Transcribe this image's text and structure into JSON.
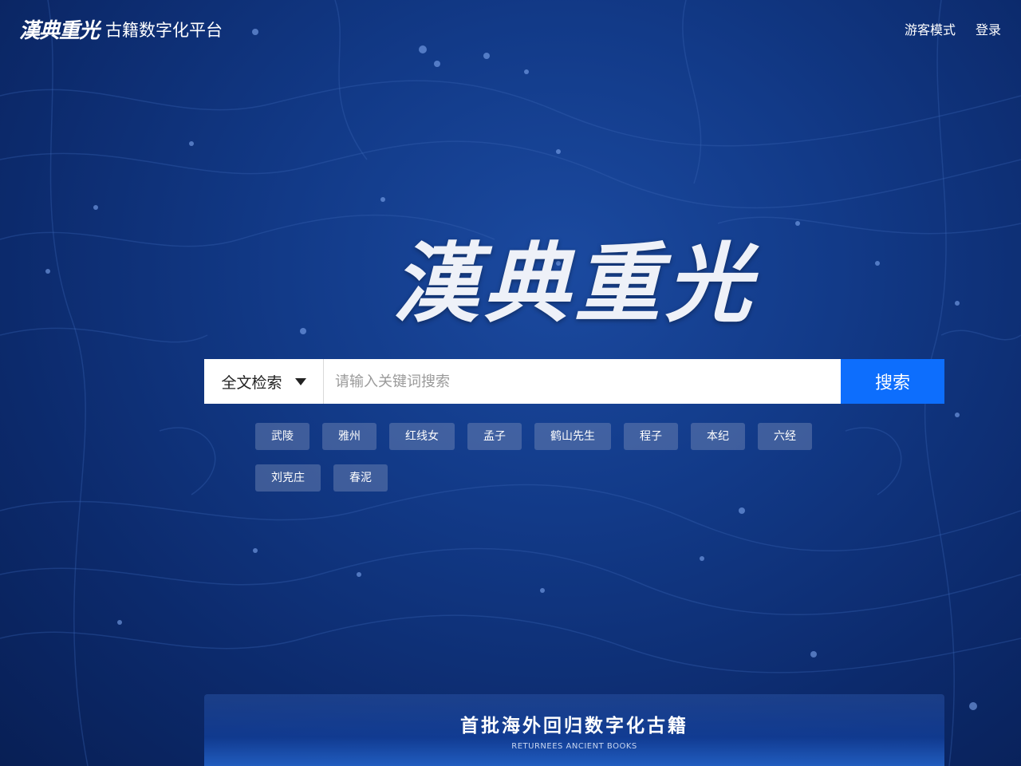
{
  "header": {
    "logo_text": "漢典重光",
    "platform_name": "古籍数字化平台",
    "guest_mode": "游客模式",
    "login": "登录"
  },
  "hero": {
    "title": "漢典重光"
  },
  "search": {
    "type_selected": "全文检索",
    "placeholder": "请输入关键词搜索",
    "button": "搜索"
  },
  "tags": [
    "武陵",
    "雅州",
    "红线女",
    "孟子",
    "鹤山先生",
    "程子",
    "本纪",
    "六经",
    "刘克庄",
    "春泥"
  ],
  "panel": {
    "title": "首批海外回归数字化古籍",
    "subtitle": "RETURNEES ANCIENT BOOKS"
  },
  "colors": {
    "background": "#0c2a6c",
    "accent": "#0d6efd",
    "tag_bg": "rgba(120,140,185,0.45)"
  }
}
